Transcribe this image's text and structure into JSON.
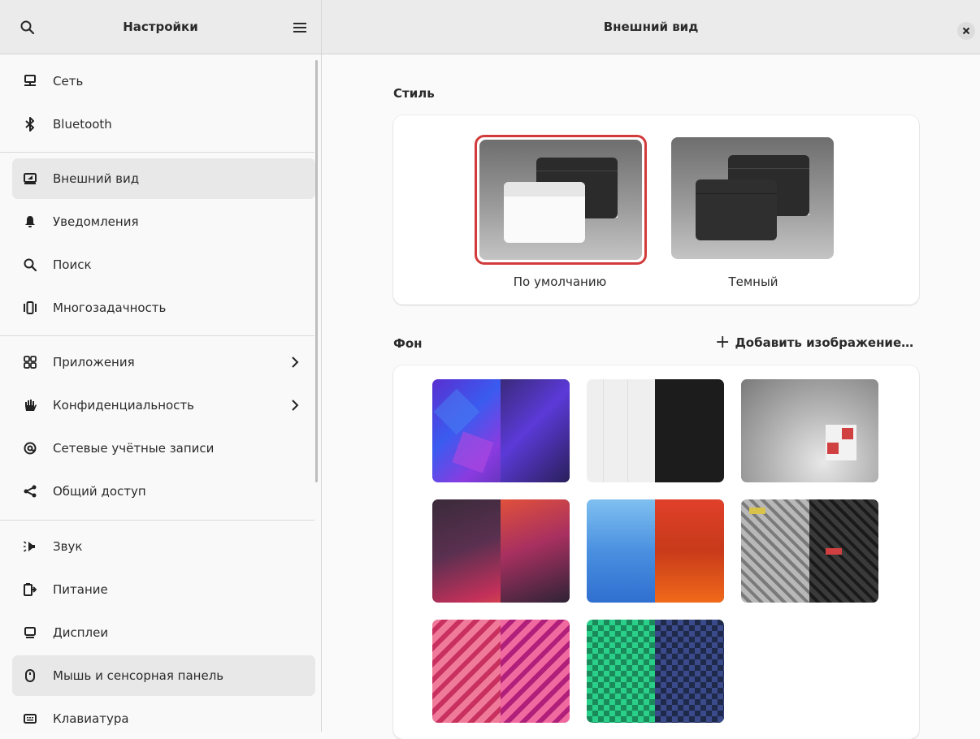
{
  "sidebar": {
    "title": "Настройки",
    "items": [
      {
        "label": "Сеть",
        "icon": "network-icon"
      },
      {
        "label": "Bluetooth",
        "icon": "bluetooth-icon"
      },
      {
        "label": "Внешний вид",
        "icon": "appearance-icon"
      },
      {
        "label": "Уведомления",
        "icon": "bell-icon"
      },
      {
        "label": "Поиск",
        "icon": "search-icon"
      },
      {
        "label": "Многозадачность",
        "icon": "multitasking-icon"
      },
      {
        "label": "Приложения",
        "icon": "apps-icon"
      },
      {
        "label": "Конфиденциальность",
        "icon": "hand-icon"
      },
      {
        "label": "Сетевые учётные записи",
        "icon": "at-icon"
      },
      {
        "label": "Общий доступ",
        "icon": "share-icon"
      },
      {
        "label": "Звук",
        "icon": "speaker-icon"
      },
      {
        "label": "Питание",
        "icon": "power-icon"
      },
      {
        "label": "Дисплеи",
        "icon": "display-icon"
      },
      {
        "label": "Мышь и сенсорная панель",
        "icon": "mouse-icon"
      },
      {
        "label": "Клавиатура",
        "icon": "keyboard-icon"
      }
    ]
  },
  "content": {
    "title": "Внешний вид",
    "style_section": {
      "title": "Стиль",
      "options": [
        {
          "label": "По умолчанию",
          "selected": true
        },
        {
          "label": "Темный",
          "selected": false
        }
      ]
    },
    "background_section": {
      "title": "Фон",
      "add_label": "Добавить изображение…"
    }
  },
  "colors": {
    "accent_selection": "#d13b3b",
    "sidebar_active": "#e8e8e8",
    "header_bg": "#ebebeb"
  }
}
